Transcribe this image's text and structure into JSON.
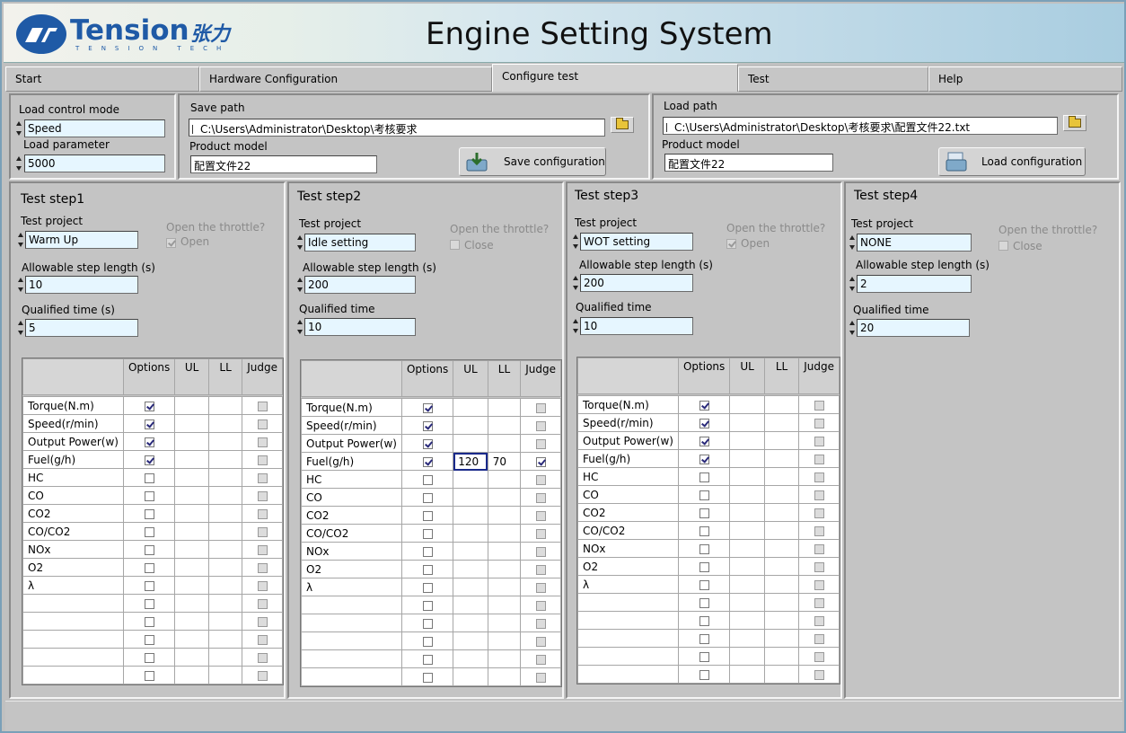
{
  "app": {
    "logo_text": "Tension",
    "logo_sub": "TENSION TECH",
    "logo_cn": "张力",
    "title": "Engine Setting System"
  },
  "tabs": [
    {
      "label": "Start"
    },
    {
      "label": "Hardware Configuration"
    },
    {
      "label": "Configure test"
    },
    {
      "label": "Test"
    },
    {
      "label": "Help"
    }
  ],
  "load_control": {
    "mode_label": "Load control mode",
    "mode_value": "Speed",
    "param_label": "Load parameter",
    "param_value": "5000"
  },
  "save": {
    "path_label": "Save path",
    "path_value": "C:\\Users\\Administrator\\Desktop\\考核要求",
    "model_label": "Product model",
    "model_value": "配置文件22",
    "button_label": "Save configuration"
  },
  "load": {
    "path_label": "Load path",
    "path_value": "C:\\Users\\Administrator\\Desktop\\考核要求\\配置文件22.txt",
    "model_label": "Product model",
    "model_value": "配置文件22",
    "button_label": "Load configuration"
  },
  "labels": {
    "test_project": "Test project",
    "throttle_q": "Open the throttle?",
    "step_length": "Allowable step length (s)",
    "qualified_time_s": "Qualified time (s)",
    "qualified_time": "Qualified time",
    "col_options": "Options",
    "col_ul": "UL",
    "col_ll": "LL",
    "col_judge": "Judge"
  },
  "steps": [
    {
      "title": "Test step1",
      "project": "Warm Up",
      "throttle_label": "Open",
      "throttle_checked": true,
      "step_length": "10",
      "qualified_time": "5"
    },
    {
      "title": "Test step2",
      "project": "Idle setting",
      "throttle_label": "Close",
      "throttle_checked": false,
      "step_length": "200",
      "qualified_time": "10"
    },
    {
      "title": "Test step3",
      "project": "WOT setting",
      "throttle_label": "Open",
      "throttle_checked": true,
      "step_length": "200",
      "qualified_time": "10"
    },
    {
      "title": "Test step4",
      "project": "NONE",
      "throttle_label": "Close",
      "throttle_checked": false,
      "step_length": "2",
      "qualified_time": "20"
    }
  ],
  "parameters": [
    "Torque(N.m)",
    "Speed(r/min)",
    "Output Power(w)",
    "Fuel(g/h)",
    "HC",
    "CO",
    "CO2",
    "CO/CO2",
    "NOx",
    "O2",
    "λ",
    "",
    "",
    "",
    "",
    ""
  ],
  "tables": [
    {
      "options": [
        1,
        1,
        1,
        1,
        0,
        0,
        0,
        0,
        0,
        0,
        0,
        0,
        0,
        0,
        0,
        0
      ],
      "ul": [
        "",
        "",
        "",
        "",
        "",
        "",
        "",
        "",
        "",
        "",
        "",
        "",
        "",
        "",
        "",
        ""
      ],
      "ll": [
        "",
        "",
        "",
        "",
        "",
        "",
        "",
        "",
        "",
        "",
        "",
        "",
        "",
        "",
        "",
        ""
      ],
      "judge": [
        0,
        0,
        0,
        0,
        0,
        0,
        0,
        0,
        0,
        0,
        0,
        0,
        0,
        0,
        0,
        0
      ]
    },
    {
      "options": [
        1,
        1,
        1,
        1,
        0,
        0,
        0,
        0,
        0,
        0,
        0,
        0,
        0,
        0,
        0,
        0
      ],
      "ul": [
        "",
        "",
        "",
        "120",
        "",
        "",
        "",
        "",
        "",
        "",
        "",
        "",
        "",
        "",
        "",
        ""
      ],
      "ll": [
        "",
        "",
        "",
        "70",
        "",
        "",
        "",
        "",
        "",
        "",
        "",
        "",
        "",
        "",
        "",
        ""
      ],
      "judge": [
        0,
        0,
        0,
        1,
        0,
        0,
        0,
        0,
        0,
        0,
        0,
        0,
        0,
        0,
        0,
        0
      ]
    },
    {
      "options": [
        1,
        1,
        1,
        1,
        0,
        0,
        0,
        0,
        0,
        0,
        0,
        0,
        0,
        0,
        0,
        0
      ],
      "ul": [
        "",
        "",
        "",
        "",
        "",
        "",
        "",
        "",
        "",
        "",
        "",
        "",
        "",
        "",
        "",
        ""
      ],
      "ll": [
        "",
        "",
        "",
        "",
        "",
        "",
        "",
        "",
        "",
        "",
        "",
        "",
        "",
        "",
        "",
        ""
      ],
      "judge": [
        0,
        0,
        0,
        0,
        0,
        0,
        0,
        0,
        0,
        0,
        0,
        0,
        0,
        0,
        0,
        0
      ]
    }
  ]
}
